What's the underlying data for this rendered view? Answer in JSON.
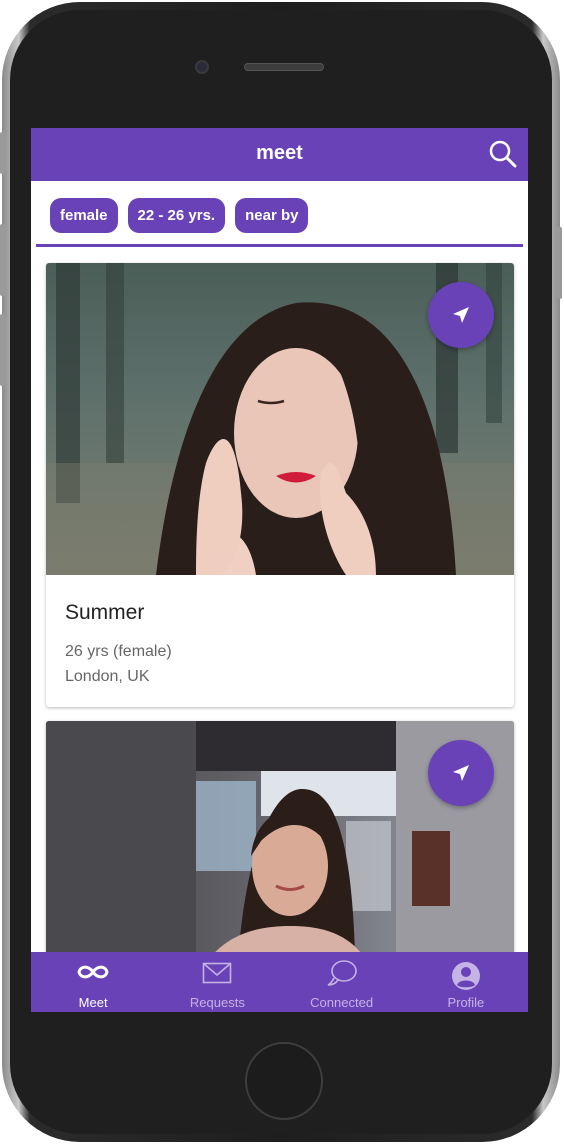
{
  "app": {
    "title": "meet"
  },
  "filters": [
    {
      "label": "female"
    },
    {
      "label": "22 - 26 yrs."
    },
    {
      "label": "near by"
    }
  ],
  "cards": [
    {
      "name": "Summer",
      "age_gender": "26 yrs (female)",
      "location": "London, UK"
    },
    {
      "name": "",
      "age_gender": "",
      "location": ""
    }
  ],
  "tabs": [
    {
      "label": "Meet",
      "icon": "infinity-icon",
      "active": true
    },
    {
      "label": "Requests",
      "icon": "envelope-icon",
      "active": false
    },
    {
      "label": "Connected",
      "icon": "chat-bubbles-icon",
      "active": false
    },
    {
      "label": "Profile",
      "icon": "user-circle-icon",
      "active": false
    }
  ],
  "colors": {
    "accent": "#6942b8",
    "inactive_tab": "#c5b3e6"
  }
}
